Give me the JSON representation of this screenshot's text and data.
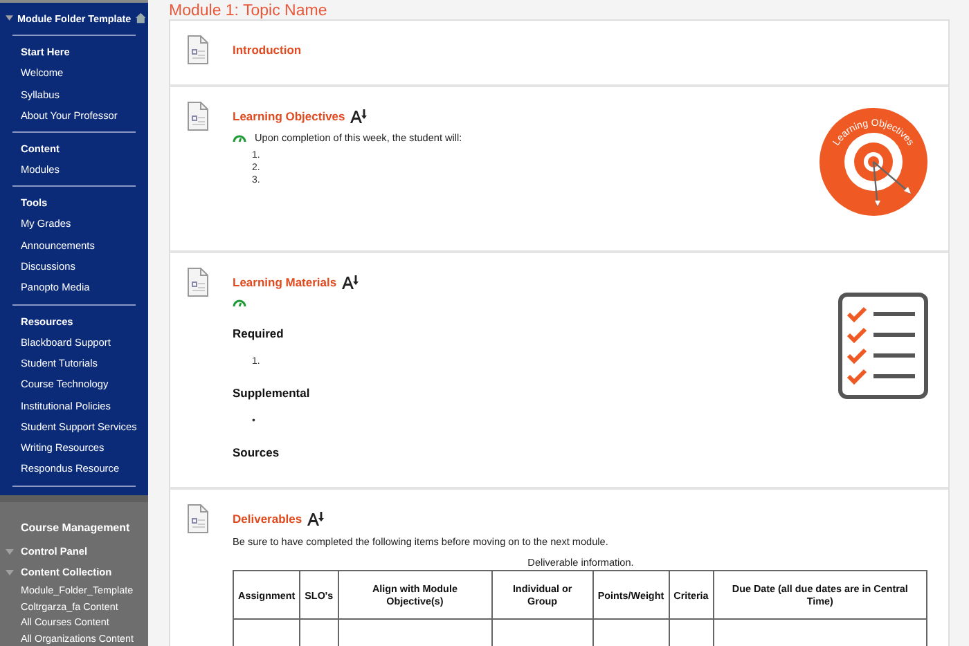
{
  "sidebar": {
    "title": "Module Folder Template",
    "sections": [
      {
        "heading": "Start Here",
        "items": [
          "Welcome",
          "Syllabus",
          "About Your Professor"
        ]
      },
      {
        "heading": "Content",
        "items": [
          "Modules"
        ]
      },
      {
        "heading": "Tools",
        "items": [
          "My Grades",
          "Announcements",
          "Discussions",
          "Panopto Media"
        ]
      },
      {
        "heading": "Resources",
        "items": [
          "Blackboard Support",
          "Student Tutorials",
          "Course Technology",
          "Institutional Policies",
          "Student Support Services",
          "Writing Resources",
          "Respondus Resource"
        ]
      }
    ]
  },
  "management": {
    "title": "Course Management",
    "panels": [
      {
        "label": "Control Panel"
      },
      {
        "label": "Content Collection",
        "children": [
          "Module_Folder_Template",
          "Coltrgarza_fa Content",
          "All Courses Content",
          "All Organizations Content"
        ]
      }
    ]
  },
  "page_title": "Module 1: Topic Name",
  "items": [
    {
      "kind": "intro",
      "title": "Introduction"
    },
    {
      "kind": "objectives",
      "title": "Learning Objectives",
      "text": "Upon completion of this week, the student will:",
      "list": [
        "1.",
        "2.",
        "3."
      ],
      "badge_text": "Learning Objectives"
    },
    {
      "kind": "materials",
      "title": "Learning Materials",
      "sections": [
        {
          "heading": "Required",
          "marker": "1."
        },
        {
          "heading": "Supplemental",
          "marker": "•"
        },
        {
          "heading": "Sources"
        }
      ]
    },
    {
      "kind": "deliverables",
      "title": "Deliverables",
      "text": "Be sure to have completed the following items before moving on to the next module.",
      "caption": "Deliverable information.",
      "columns": [
        "Assignment",
        "SLO's",
        "Align with Module Objective(s)",
        "Individual or Group",
        "Points/Weight",
        "Criteria",
        "Due Date (all due dates are in Central Time)"
      ]
    }
  ]
}
